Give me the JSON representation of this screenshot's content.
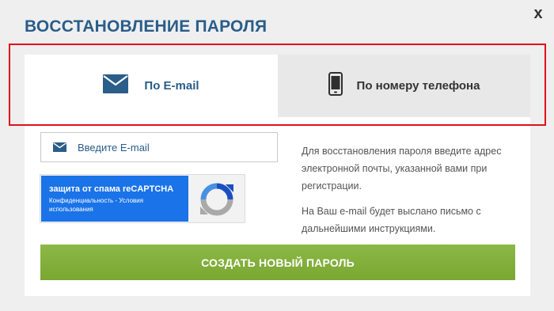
{
  "modal": {
    "title": "ВОССТАНОВЛЕНИЕ ПАРОЛЯ",
    "close_label": "x"
  },
  "tabs": [
    {
      "label": "По E-mail",
      "icon": "envelope-icon",
      "active": true
    },
    {
      "label": "По номеру телефона",
      "icon": "phone-icon",
      "active": false
    }
  ],
  "form": {
    "email_placeholder": "Введите E-mail",
    "email_value": "",
    "submit_label": "СОЗДАТЬ НОВЫЙ ПАРОЛЬ"
  },
  "captcha": {
    "title": "защита от спама reCAPTCHA",
    "subtitle": "Конфиденциальность - Условия использования",
    "icon": "recaptcha-icon"
  },
  "help": {
    "paragraph1": "Для восстановления пароля введите адрес электронной почты, указанной вами при регистрации.",
    "paragraph2": "На Ваш e-mail будет выслано письмо с дальнейшими инструкциями."
  },
  "colors": {
    "accent": "#2a5d8a",
    "submit": "#84b03d",
    "highlight": "#e0101a",
    "recaptcha_blue": "#1a73e8"
  }
}
